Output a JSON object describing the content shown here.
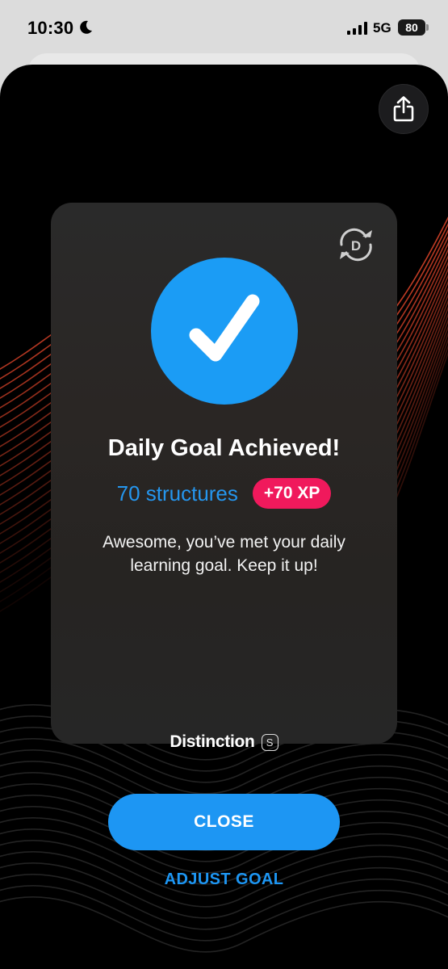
{
  "status_bar": {
    "time": "10:30",
    "network": "5G",
    "battery": "80",
    "icons": [
      "moon-icon",
      "signal-icon",
      "battery-icon"
    ]
  },
  "toolbar": {
    "share_icon": "share-icon"
  },
  "card": {
    "sync_icon": "refresh-icon",
    "check_icon": "checkmark-icon",
    "title": "Daily Goal Achieved!",
    "structures": "70 structures",
    "xp_badge": "+70 XP",
    "message": "Awesome, you’ve met your daily learning goal. Keep it up!",
    "brand_name": "Distinction",
    "brand_badge": "S"
  },
  "actions": {
    "close_label": "CLOSE",
    "adjust_label": "ADJUST GOAL"
  },
  "colors": {
    "accent_blue": "#1d96f3",
    "xp_pink": "#f0195c",
    "card_bg": "#2a2a2a",
    "wave_red": "#e0452a"
  }
}
